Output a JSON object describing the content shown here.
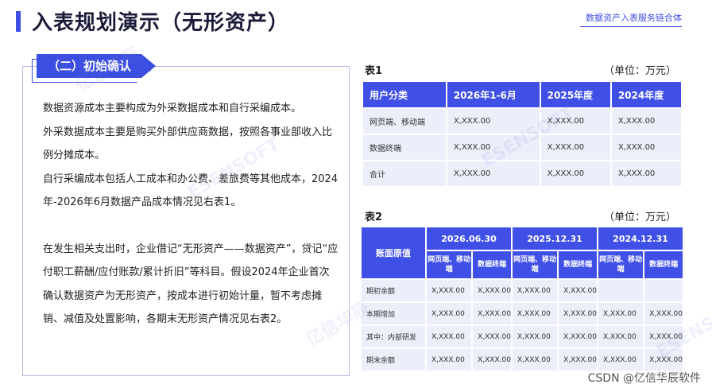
{
  "header": {
    "title": "入表规划演示（无形资产）",
    "brand": "数据资产入表服务链合体"
  },
  "section": {
    "tag": "（二）初始确认",
    "paragraphs": [
      "数据资源成本主要构成为外采数据成本和自行采编成本。",
      "外采数据成本主要是购买外部供应商数据，按照各事业部收入比例分摊成本。",
      "自行采编成本包括人工成本和办公费、差旅费等其他成本，2024年-2026年6月数据产品成本情况见右表1。",
      "在发生相关支出时，企业借记“无形资产——数据资产”，贷记“应付职工薪酬/应付账款/累计折旧”等科目。假设2024年企业首次确认数据资产为无形资产，按成本进行初始计量，暂不考虑摊销、减值及处置影响，各期末无形资产情况见右表2。"
    ]
  },
  "table1": {
    "caption": "表1",
    "unit": "（单位：万元）",
    "headers": [
      "用户分类",
      "2026年1-6月",
      "2025年度",
      "2024年度"
    ],
    "rows": [
      [
        "网页端、移动端",
        "X,XXX.00",
        "X,XXX.00",
        "X,XXX.00"
      ],
      [
        "数据终端",
        "X,XXX.00",
        "X,XXX.00",
        "X,XXX.00"
      ],
      [
        "合计",
        "X,XXX.00",
        "X,XXX.00",
        "X,XXX.00"
      ]
    ]
  },
  "table2": {
    "caption": "表2",
    "unit": "（单位：万元）",
    "corner": "账面原值",
    "dates": [
      "2026.06.30",
      "2025.12.31",
      "2024.12.31"
    ],
    "subheaders": [
      "网页端、移动端",
      "数据终端",
      "网页端、移动端",
      "数据终端",
      "网页端、移动端",
      "数据终端"
    ],
    "rows": [
      [
        "期初余额",
        "X,XXX.00",
        "X,XXX.00",
        "X,XXX.00",
        "X,XXX.00",
        "",
        ""
      ],
      [
        "本期增加",
        "X,XXX.00",
        "X,XXX.00",
        "X,XXX.00",
        "X,XXX.00",
        "X,XXX.00",
        "X,XXX.00"
      ],
      [
        "其中：内部研发",
        "X,XXX.00",
        "X,XXX.00",
        "X,XXX.00",
        "X,XXX.00",
        "X,XXX.00",
        "X,XXX.00"
      ],
      [
        "期末余额",
        "X,XXX.00",
        "X,XXX.00",
        "X,XXX.00",
        "X,XXX.00",
        "X,XXX.00",
        "X,XXX.00"
      ]
    ]
  },
  "footer": {
    "credit": "CSDN @亿信华辰软件"
  },
  "watermark": {
    "cn": "亿信华辰",
    "en": "ESENSOFT"
  }
}
